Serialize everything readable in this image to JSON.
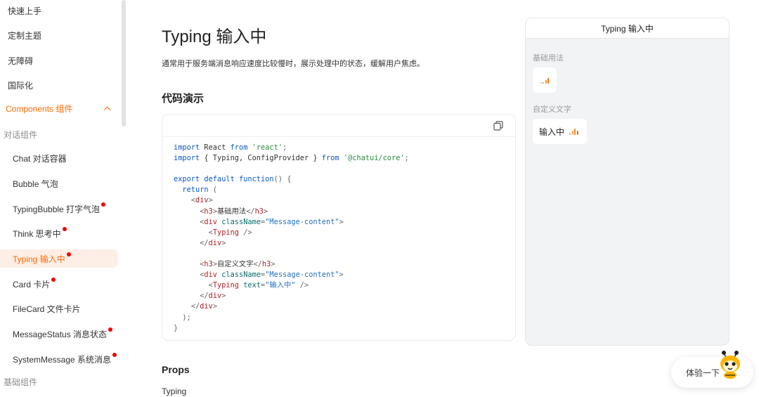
{
  "sidebar": {
    "top_items": [
      {
        "label": "快速上手"
      },
      {
        "label": "定制主题"
      },
      {
        "label": "无障碍"
      },
      {
        "label": "国际化"
      }
    ],
    "section_label": "Components 组件",
    "group_dialog": "对话组件",
    "dialog_items": [
      {
        "label": "Chat 对话容器",
        "dot": false
      },
      {
        "label": "Bubble 气泡",
        "dot": false
      },
      {
        "label": "TypingBubble 打字气泡",
        "dot": true
      },
      {
        "label": "Think 思考中",
        "dot": true
      },
      {
        "label": "Typing 输入中",
        "dot": true,
        "active": true
      },
      {
        "label": "Card 卡片",
        "dot": true
      },
      {
        "label": "FileCard 文件卡片",
        "dot": false
      },
      {
        "label": "MessageStatus 消息状态",
        "dot": true
      },
      {
        "label": "SystemMessage 系统消息",
        "dot": true
      }
    ],
    "group_basic": "基础组件"
  },
  "main": {
    "title": "Typing 输入中",
    "description": "通常用于服务端消息响应速度比较慢时，展示处理中的状态，缓解用户焦虑。",
    "demo_heading": "代码演示",
    "props_heading": "Props",
    "props_sub": "Typing"
  },
  "code": {
    "line1_kw1": "import",
    "line1_mid": " React ",
    "line1_kw2": "from",
    "line1_str": " 'react'",
    "line1_end": ";",
    "line2_kw1": "import",
    "line2_mid": " { Typing, ConfigProvider } ",
    "line2_kw2": "from",
    "line2_str": " '@chatui/core'",
    "line2_end": ";",
    "line4_kw1": "export default function",
    "line4_end": "() {",
    "line5_kw": "return",
    "line5_end": " (",
    "div": "div",
    "h3": "h3",
    "className": "className",
    "msg_content": "\"Message-content\"",
    "typing_tag": "Typing",
    "text_attr": "text",
    "text_val": "\"输入中\"",
    "h3_basic": "基础用法",
    "h3_custom": "自定义文字",
    "close_paren": ");",
    "close_brace": "}"
  },
  "preview": {
    "header": "Typing 输入中",
    "label_basic": "基础用法",
    "label_custom": "自定义文字",
    "custom_text": "输入中"
  },
  "try_button": {
    "label": "体验一下"
  },
  "colors": {
    "accent": "#ff6a00",
    "dot": "#f00000",
    "active_bg": "#fdeee6"
  }
}
